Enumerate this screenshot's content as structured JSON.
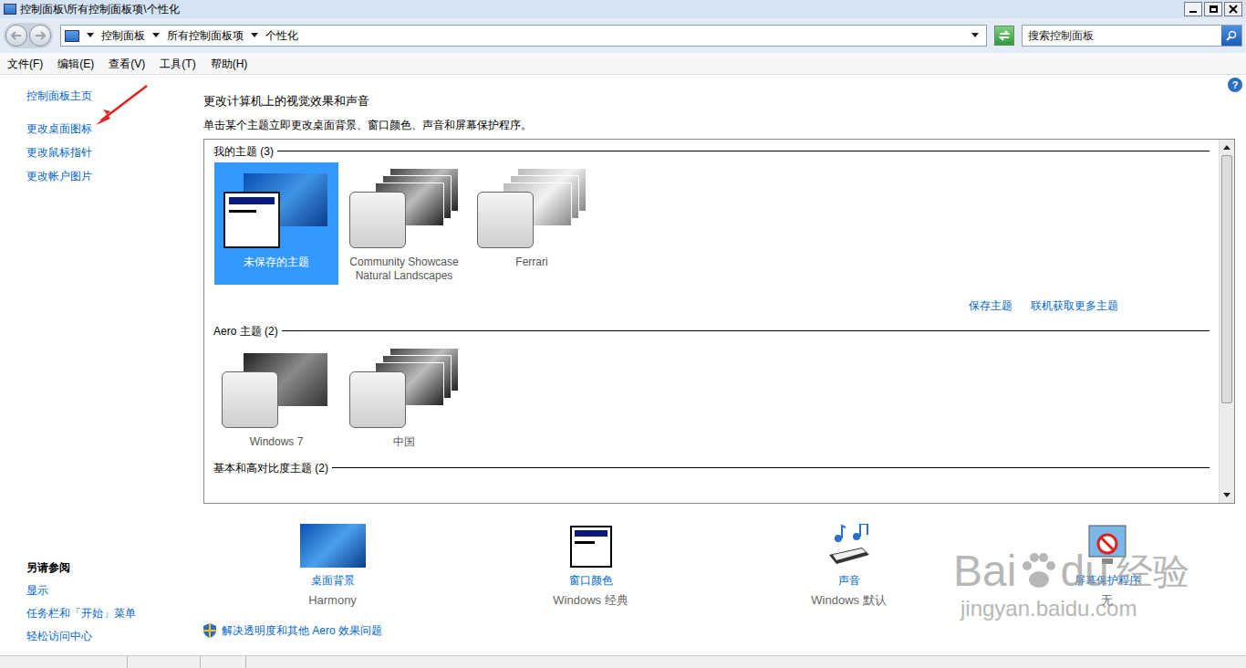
{
  "window": {
    "title": "控制面板\\所有控制面板项\\个性化"
  },
  "address": {
    "crumbs": [
      "控制面板",
      "所有控制面板项",
      "个性化"
    ]
  },
  "search": {
    "placeholder": "搜索控制面板"
  },
  "menu": [
    "文件(F)",
    "编辑(E)",
    "查看(V)",
    "工具(T)",
    "帮助(H)"
  ],
  "help": "?",
  "sidebar": {
    "items": [
      {
        "label": "控制面板主页",
        "annotated": false
      },
      {
        "label": "更改桌面图标",
        "annotated": true
      },
      {
        "label": "更改鼠标指针",
        "annotated": false
      },
      {
        "label": "更改帐户图片",
        "annotated": false
      }
    ],
    "see_also": {
      "title": "另请参阅",
      "items": [
        "显示",
        "任务栏和「开始」菜单",
        "轻松访问中心"
      ]
    }
  },
  "content": {
    "heading": "更改计算机上的视觉效果和声音",
    "description": "单击某个主题立即更改桌面背景、窗口颜色、声音和屏幕保护程序。"
  },
  "theme_groups": [
    {
      "title": "我的主题 (3)",
      "themes": [
        {
          "name": "未保存的主题",
          "selected": true,
          "kind": "desktop"
        },
        {
          "name": "Community Showcase Natural Landscapes",
          "selected": false,
          "kind": "slideshow"
        },
        {
          "name": "Ferrari",
          "selected": false,
          "kind": "light"
        }
      ],
      "links": [
        "保存主题",
        "联机获取更多主题"
      ]
    },
    {
      "title": "Aero 主题 (2)",
      "themes": [
        {
          "name": "Windows 7",
          "selected": false,
          "kind": "single"
        },
        {
          "name": "中国",
          "selected": false,
          "kind": "slideshow"
        }
      ],
      "links": []
    },
    {
      "title": "基本和高对比度主题 (2)",
      "themes": [],
      "links": []
    }
  ],
  "settings": [
    {
      "label": "桌面背景",
      "value": "Harmony",
      "kind": "background"
    },
    {
      "label": "窗口颜色",
      "value": "Windows 经典",
      "kind": "color"
    },
    {
      "label": "声音",
      "value": "Windows 默认",
      "kind": "sound"
    },
    {
      "label": "屏幕保护程序",
      "value": "无",
      "kind": "screensaver"
    }
  ],
  "troubleshoot": "解决透明度和其他 Aero 效果问题",
  "watermark": {
    "left": "Bai",
    "right": "du",
    "cn": "经验",
    "url": "jingyan.baidu.com"
  }
}
